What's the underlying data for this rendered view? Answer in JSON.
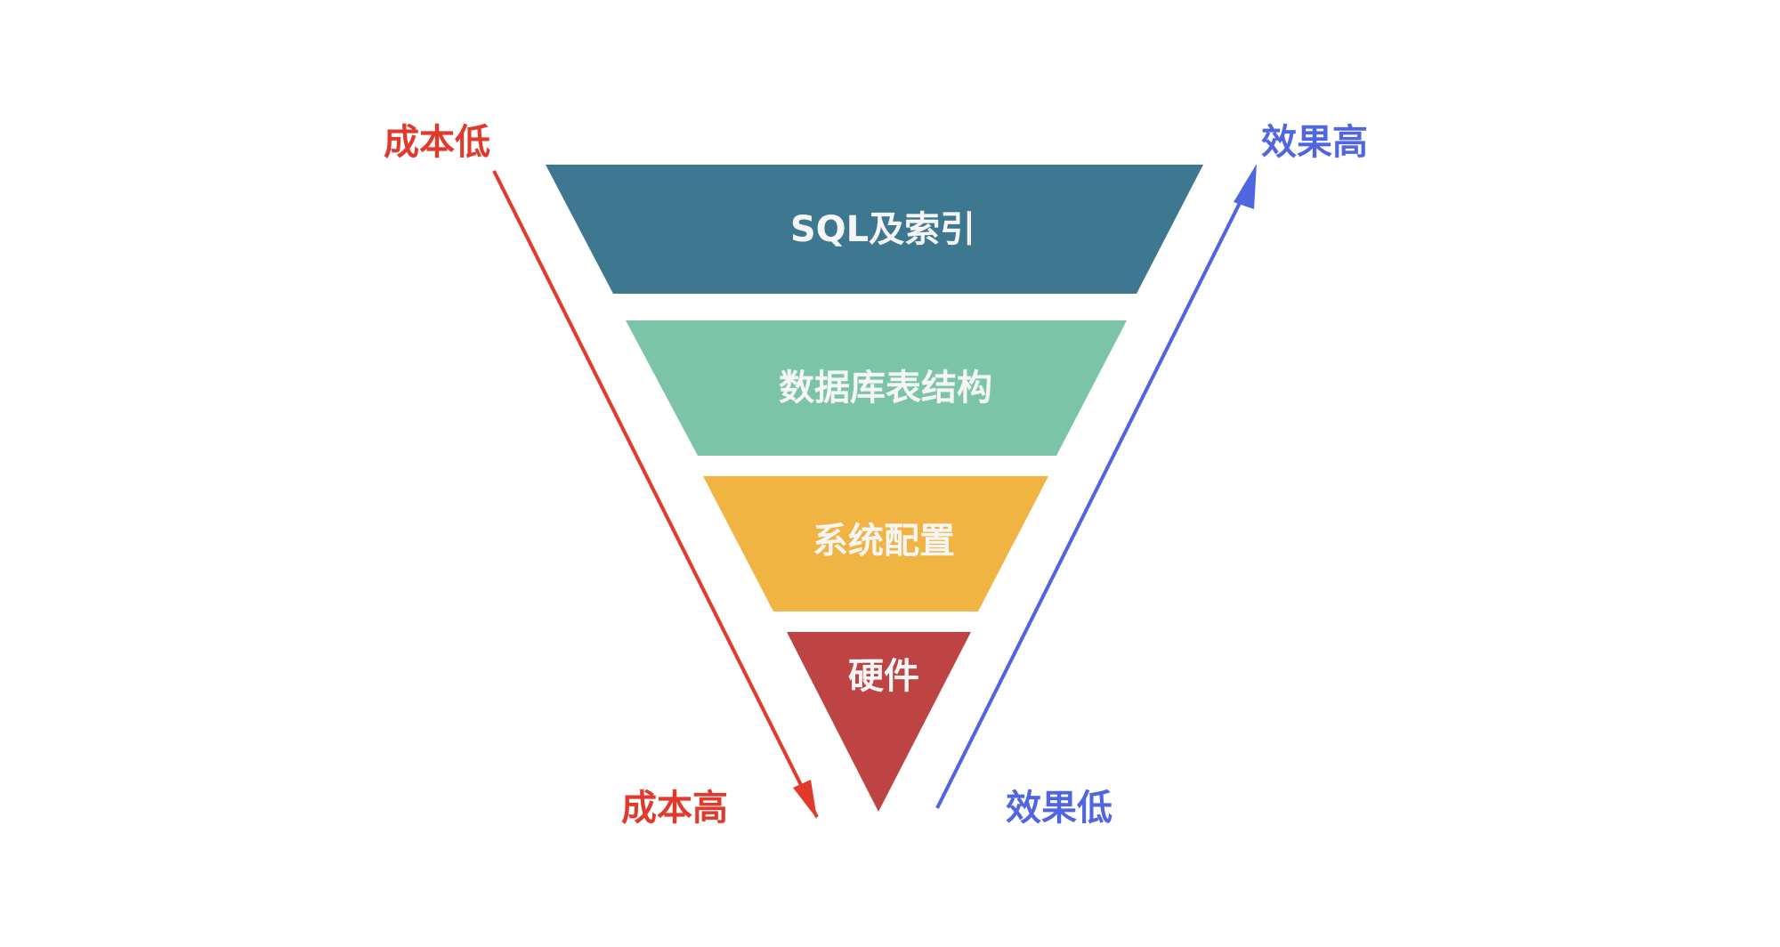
{
  "funnel": {
    "layers": [
      {
        "label": "SQL及索引",
        "color": "#3E7790"
      },
      {
        "label": "数据库表结构",
        "color": "#7BC4A8"
      },
      {
        "label": "系统配置",
        "color": "#EFB441"
      },
      {
        "label": "硬件",
        "color": "#BD4443"
      }
    ],
    "label_color": "#F5F5F5"
  },
  "cost_axis": {
    "top_label": "成本低",
    "bottom_label": "成本高",
    "color": "#E03A2C"
  },
  "effect_axis": {
    "top_label": "效果高",
    "bottom_label": "效果低",
    "color": "#4F66E0"
  }
}
